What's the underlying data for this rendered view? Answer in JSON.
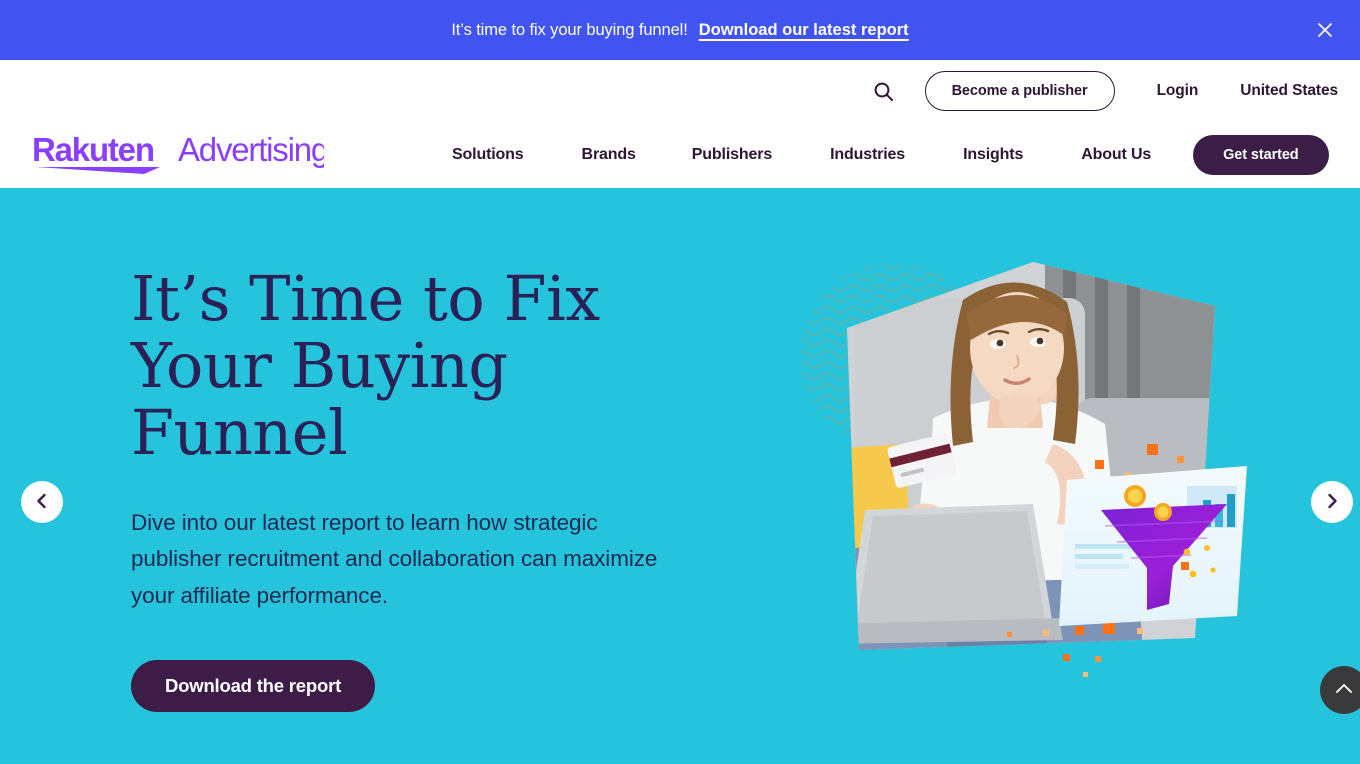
{
  "banner": {
    "message": "It’s time to fix your buying funnel!",
    "link_label": "Download our latest report",
    "close_icon": "close-icon",
    "background_color": "#4154ef",
    "text_color": "#ffffff"
  },
  "header": {
    "logo": {
      "brand": "Rakuten",
      "product": "Advertising",
      "color": "#8a3ffc"
    },
    "search_icon": "search-icon",
    "publisher_button": "Become a publisher",
    "login_link": "Login",
    "locale": "United States",
    "get_started_button": "Get started",
    "nav_items": [
      {
        "label": "Solutions"
      },
      {
        "label": "Brands"
      },
      {
        "label": "Publishers"
      },
      {
        "label": "Industries"
      },
      {
        "label": "Insights"
      },
      {
        "label": "About Us"
      }
    ],
    "accent_color": "#2e1533",
    "cta_color": "#3b1d47"
  },
  "hero": {
    "title": "It’s Time to Fix Your Buying Funnel",
    "subtitle": "Dive into our latest report to learn how strategic publisher recruitment and collaboration can maximize your affiliate performance.",
    "cta_label": "Download the report",
    "background_color": "#25c4dc",
    "title_color": "#2b2157",
    "cta_color": "#3d1d48",
    "prev_icon": "chevron-left-icon",
    "next_icon": "chevron-right-icon",
    "image_alt": "Woman holding a credit card while using a laptop, with a purple marketing funnel graphic"
  },
  "scroll_top": {
    "icon": "chevron-up-icon",
    "background_color": "#3a3a3c"
  }
}
